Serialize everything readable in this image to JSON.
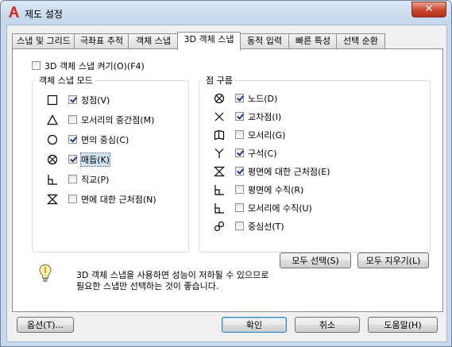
{
  "window": {
    "title": "제도 설정",
    "close_glyph": "✕"
  },
  "tabs": [
    {
      "label": "스냅 및 그리드",
      "active": false
    },
    {
      "label": "극좌표 추적",
      "active": false
    },
    {
      "label": "객체 스냅",
      "active": false
    },
    {
      "label": "3D 객체 스냅",
      "active": true
    },
    {
      "label": "동적 입력",
      "active": false
    },
    {
      "label": "빠른 특성",
      "active": false
    },
    {
      "label": "선택 순환",
      "active": false
    }
  ],
  "enable_3d_osnap": {
    "label": "3D 객체 스냅 켜기(O)(F4)",
    "checked": false
  },
  "object_snap_modes": {
    "title": "객체 스냅 모드",
    "items": [
      {
        "label": "정점(V)",
        "checked": true,
        "icon": "square-icon"
      },
      {
        "label": "모서리의 중간점(M)",
        "checked": false,
        "icon": "triangle-icon"
      },
      {
        "label": "면의 중심(C)",
        "checked": true,
        "icon": "circle-icon"
      },
      {
        "label": "매듭(K)",
        "checked": true,
        "icon": "knot-icon"
      },
      {
        "label": "직교(P)",
        "checked": false,
        "icon": "perpendicular-icon"
      },
      {
        "label": "면에 대한 근처점(N)",
        "checked": false,
        "icon": "hourglass-icon"
      }
    ]
  },
  "point_cloud": {
    "title": "점 구름",
    "items": [
      {
        "label": "노드(D)",
        "checked": true,
        "icon": "node-icon"
      },
      {
        "label": "교차점(I)",
        "checked": true,
        "icon": "intersection-icon"
      },
      {
        "label": "모서리(G)",
        "checked": false,
        "icon": "edge-icon"
      },
      {
        "label": "구석(C)",
        "checked": true,
        "icon": "corner-icon"
      },
      {
        "label": "평면에 대한 근처점(E)",
        "checked": true,
        "icon": "hourglass-icon"
      },
      {
        "label": "평면에 수직(R)",
        "checked": false,
        "icon": "perpendicular-icon"
      },
      {
        "label": "모서리에 수직(U)",
        "checked": false,
        "icon": "perpendicular-icon"
      },
      {
        "label": "중심선(T)",
        "checked": false,
        "icon": "centerline-icon"
      }
    ]
  },
  "buttons": {
    "select_all": "모두 선택(S)",
    "clear_all": "모두 지우기(L)",
    "options": "옵션(T)...",
    "ok": "확인",
    "cancel": "취소",
    "help": "도움말(H)"
  },
  "hint": {
    "line1": "3D 객체 스냅을 사용하면 성능이 저하될 수 있으므로",
    "line2": "필요한 스냅만 선택하는 것이 좋습니다."
  },
  "colors": {
    "accent": "#d0312d",
    "titlebar": "#c7d9ee",
    "check": "#1c3c78"
  }
}
